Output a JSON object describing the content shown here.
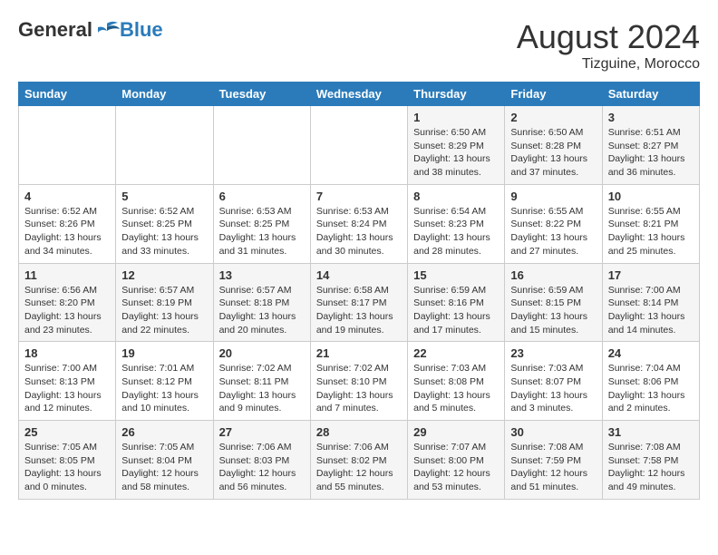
{
  "logo": {
    "general": "General",
    "blue": "Blue"
  },
  "header": {
    "month_year": "August 2024",
    "location": "Tizguine, Morocco"
  },
  "weekdays": [
    "Sunday",
    "Monday",
    "Tuesday",
    "Wednesday",
    "Thursday",
    "Friday",
    "Saturday"
  ],
  "weeks": [
    [
      {
        "day": "",
        "info": ""
      },
      {
        "day": "",
        "info": ""
      },
      {
        "day": "",
        "info": ""
      },
      {
        "day": "",
        "info": ""
      },
      {
        "day": "1",
        "info": "Sunrise: 6:50 AM\nSunset: 8:29 PM\nDaylight: 13 hours\nand 38 minutes."
      },
      {
        "day": "2",
        "info": "Sunrise: 6:50 AM\nSunset: 8:28 PM\nDaylight: 13 hours\nand 37 minutes."
      },
      {
        "day": "3",
        "info": "Sunrise: 6:51 AM\nSunset: 8:27 PM\nDaylight: 13 hours\nand 36 minutes."
      }
    ],
    [
      {
        "day": "4",
        "info": "Sunrise: 6:52 AM\nSunset: 8:26 PM\nDaylight: 13 hours\nand 34 minutes."
      },
      {
        "day": "5",
        "info": "Sunrise: 6:52 AM\nSunset: 8:25 PM\nDaylight: 13 hours\nand 33 minutes."
      },
      {
        "day": "6",
        "info": "Sunrise: 6:53 AM\nSunset: 8:25 PM\nDaylight: 13 hours\nand 31 minutes."
      },
      {
        "day": "7",
        "info": "Sunrise: 6:53 AM\nSunset: 8:24 PM\nDaylight: 13 hours\nand 30 minutes."
      },
      {
        "day": "8",
        "info": "Sunrise: 6:54 AM\nSunset: 8:23 PM\nDaylight: 13 hours\nand 28 minutes."
      },
      {
        "day": "9",
        "info": "Sunrise: 6:55 AM\nSunset: 8:22 PM\nDaylight: 13 hours\nand 27 minutes."
      },
      {
        "day": "10",
        "info": "Sunrise: 6:55 AM\nSunset: 8:21 PM\nDaylight: 13 hours\nand 25 minutes."
      }
    ],
    [
      {
        "day": "11",
        "info": "Sunrise: 6:56 AM\nSunset: 8:20 PM\nDaylight: 13 hours\nand 23 minutes."
      },
      {
        "day": "12",
        "info": "Sunrise: 6:57 AM\nSunset: 8:19 PM\nDaylight: 13 hours\nand 22 minutes."
      },
      {
        "day": "13",
        "info": "Sunrise: 6:57 AM\nSunset: 8:18 PM\nDaylight: 13 hours\nand 20 minutes."
      },
      {
        "day": "14",
        "info": "Sunrise: 6:58 AM\nSunset: 8:17 PM\nDaylight: 13 hours\nand 19 minutes."
      },
      {
        "day": "15",
        "info": "Sunrise: 6:59 AM\nSunset: 8:16 PM\nDaylight: 13 hours\nand 17 minutes."
      },
      {
        "day": "16",
        "info": "Sunrise: 6:59 AM\nSunset: 8:15 PM\nDaylight: 13 hours\nand 15 minutes."
      },
      {
        "day": "17",
        "info": "Sunrise: 7:00 AM\nSunset: 8:14 PM\nDaylight: 13 hours\nand 14 minutes."
      }
    ],
    [
      {
        "day": "18",
        "info": "Sunrise: 7:00 AM\nSunset: 8:13 PM\nDaylight: 13 hours\nand 12 minutes."
      },
      {
        "day": "19",
        "info": "Sunrise: 7:01 AM\nSunset: 8:12 PM\nDaylight: 13 hours\nand 10 minutes."
      },
      {
        "day": "20",
        "info": "Sunrise: 7:02 AM\nSunset: 8:11 PM\nDaylight: 13 hours\nand 9 minutes."
      },
      {
        "day": "21",
        "info": "Sunrise: 7:02 AM\nSunset: 8:10 PM\nDaylight: 13 hours\nand 7 minutes."
      },
      {
        "day": "22",
        "info": "Sunrise: 7:03 AM\nSunset: 8:08 PM\nDaylight: 13 hours\nand 5 minutes."
      },
      {
        "day": "23",
        "info": "Sunrise: 7:03 AM\nSunset: 8:07 PM\nDaylight: 13 hours\nand 3 minutes."
      },
      {
        "day": "24",
        "info": "Sunrise: 7:04 AM\nSunset: 8:06 PM\nDaylight: 13 hours\nand 2 minutes."
      }
    ],
    [
      {
        "day": "25",
        "info": "Sunrise: 7:05 AM\nSunset: 8:05 PM\nDaylight: 13 hours\nand 0 minutes."
      },
      {
        "day": "26",
        "info": "Sunrise: 7:05 AM\nSunset: 8:04 PM\nDaylight: 12 hours\nand 58 minutes."
      },
      {
        "day": "27",
        "info": "Sunrise: 7:06 AM\nSunset: 8:03 PM\nDaylight: 12 hours\nand 56 minutes."
      },
      {
        "day": "28",
        "info": "Sunrise: 7:06 AM\nSunset: 8:02 PM\nDaylight: 12 hours\nand 55 minutes."
      },
      {
        "day": "29",
        "info": "Sunrise: 7:07 AM\nSunset: 8:00 PM\nDaylight: 12 hours\nand 53 minutes."
      },
      {
        "day": "30",
        "info": "Sunrise: 7:08 AM\nSunset: 7:59 PM\nDaylight: 12 hours\nand 51 minutes."
      },
      {
        "day": "31",
        "info": "Sunrise: 7:08 AM\nSunset: 7:58 PM\nDaylight: 12 hours\nand 49 minutes."
      }
    ]
  ]
}
